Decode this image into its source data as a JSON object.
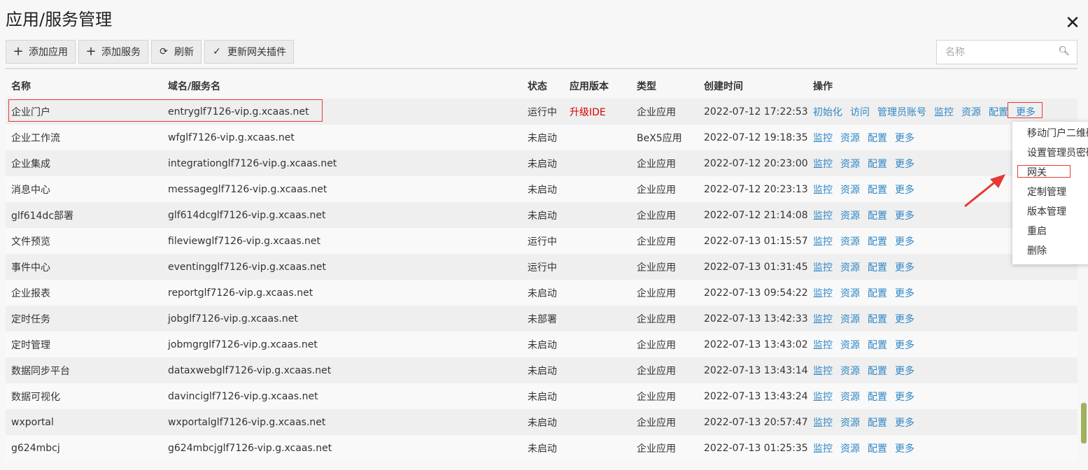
{
  "header": {
    "title": "应用/服务管理",
    "close_label": "✕"
  },
  "toolbar": {
    "add_app": "添加应用",
    "add_service": "添加服务",
    "refresh": "刷新",
    "update_plugin": "更新网关插件"
  },
  "search": {
    "placeholder": "名称"
  },
  "table": {
    "headers": [
      "名称",
      "域名/服务名",
      "状态",
      "应用版本",
      "类型",
      "创建时间",
      "操作"
    ],
    "rows": [
      {
        "name": "企业门户",
        "domain": "entryglf7126-vip.g.xcaas.net",
        "status": "运行中",
        "version": "升级IDE",
        "type": "企业应用",
        "created": "2022-07-12 17:22:53",
        "ops": [
          "初始化",
          "访问",
          "管理员账号",
          "监控",
          "资源",
          "配置",
          "更多"
        ]
      },
      {
        "name": "企业工作流",
        "domain": "wfglf7126-vip.g.xcaas.net",
        "status": "未启动",
        "version": "",
        "type": "BeX5应用",
        "created": "2022-07-12 19:18:35",
        "ops": [
          "监控",
          "资源",
          "配置",
          "更多"
        ]
      },
      {
        "name": "企业集成",
        "domain": "integrationglf7126-vip.g.xcaas.net",
        "status": "未启动",
        "version": "",
        "type": "企业应用",
        "created": "2022-07-12 20:23:00",
        "ops": [
          "监控",
          "资源",
          "配置",
          "更多"
        ]
      },
      {
        "name": "消息中心",
        "domain": "messageglf7126-vip.g.xcaas.net",
        "status": "未启动",
        "version": "",
        "type": "企业应用",
        "created": "2022-07-12 20:23:13",
        "ops": [
          "监控",
          "资源",
          "配置",
          "更多"
        ]
      },
      {
        "name": "glf614dc部署",
        "domain": "glf614dcglf7126-vip.g.xcaas.net",
        "status": "未启动",
        "version": "",
        "type": "企业应用",
        "created": "2022-07-12 21:14:08",
        "ops": [
          "监控",
          "资源",
          "配置",
          "更多"
        ]
      },
      {
        "name": "文件预览",
        "domain": "fileviewglf7126-vip.g.xcaas.net",
        "status": "运行中",
        "version": "",
        "type": "企业应用",
        "created": "2022-07-13 01:15:57",
        "ops": [
          "监控",
          "资源",
          "配置",
          "更多"
        ]
      },
      {
        "name": "事件中心",
        "domain": "eventingglf7126-vip.g.xcaas.net",
        "status": "运行中",
        "version": "",
        "type": "企业应用",
        "created": "2022-07-13 01:31:45",
        "ops": [
          "监控",
          "资源",
          "配置",
          "更多"
        ]
      },
      {
        "name": "企业报表",
        "domain": "reportglf7126-vip.g.xcaas.net",
        "status": "未启动",
        "version": "",
        "type": "企业应用",
        "created": "2022-07-13 09:54:22",
        "ops": [
          "监控",
          "资源",
          "配置",
          "更多"
        ]
      },
      {
        "name": "定时任务",
        "domain": "jobglf7126-vip.g.xcaas.net",
        "status": "未部署",
        "version": "",
        "type": "企业应用",
        "created": "2022-07-13 13:42:33",
        "ops": [
          "监控",
          "资源",
          "配置",
          "更多"
        ]
      },
      {
        "name": "定时管理",
        "domain": "jobmgrglf7126-vip.g.xcaas.net",
        "status": "未启动",
        "version": "",
        "type": "企业应用",
        "created": "2022-07-13 13:43:02",
        "ops": [
          "监控",
          "资源",
          "配置",
          "更多"
        ]
      },
      {
        "name": "数据同步平台",
        "domain": "dataxwebglf7126-vip.g.xcaas.net",
        "status": "未启动",
        "version": "",
        "type": "企业应用",
        "created": "2022-07-13 13:43:14",
        "ops": [
          "监控",
          "资源",
          "配置",
          "更多"
        ]
      },
      {
        "name": "数据可视化",
        "domain": "davinciglf7126-vip.g.xcaas.net",
        "status": "未启动",
        "version": "",
        "type": "企业应用",
        "created": "2022-07-13 13:43:24",
        "ops": [
          "监控",
          "资源",
          "配置",
          "更多"
        ]
      },
      {
        "name": "wxportal",
        "domain": "wxportalglf7126-vip.g.xcaas.net",
        "status": "未启动",
        "version": "",
        "type": "企业应用",
        "created": "2022-07-13 20:57:47",
        "ops": [
          "监控",
          "资源",
          "配置",
          "更多"
        ]
      },
      {
        "name": "g624mbcj",
        "domain": "g624mbcjglf7126-vip.g.xcaas.net",
        "status": "未启动",
        "version": "",
        "type": "企业应用",
        "created": "2022-07-13 01:25:35",
        "ops": [
          "监控",
          "资源",
          "配置",
          "更多"
        ]
      }
    ]
  },
  "more_menu": {
    "items": [
      "移动门户二维码",
      "设置管理员密码",
      "网关",
      "定制管理",
      "版本管理",
      "重启",
      "删除"
    ]
  },
  "colors": {
    "link": "#2f87c6",
    "highlight": "#e53935",
    "version_red": "#d80000"
  }
}
